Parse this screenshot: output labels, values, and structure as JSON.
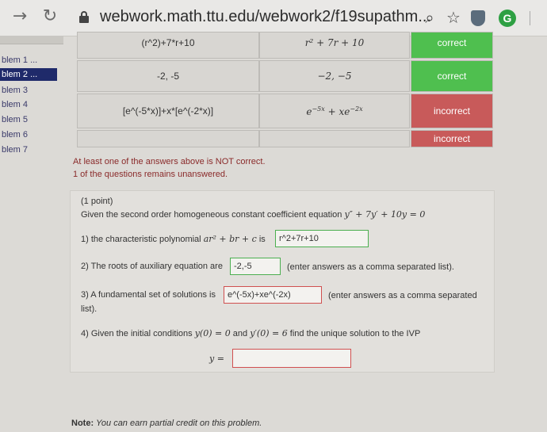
{
  "browser": {
    "url": "webwork.math.ttu.edu/webwork2/f19supathm...",
    "g_label": "G"
  },
  "sidebar": {
    "items": [
      {
        "label": "blem 1 ..."
      },
      {
        "label": "blem 2 ..."
      },
      {
        "label": "blem 3"
      },
      {
        "label": "blem 4"
      },
      {
        "label": "blem 5"
      },
      {
        "label": "blem 6"
      },
      {
        "label": "blem 7"
      }
    ]
  },
  "results": {
    "rows": [
      {
        "entered": "(r^2)+7*r+10",
        "preview": "r² + 7r + 10",
        "result": "correct"
      },
      {
        "entered": "-2, -5",
        "preview": "−2, −5",
        "result": "correct"
      },
      {
        "entered": "[e^(-5*x)]+x*[e^(-2*x)]",
        "preview": "e^{−5x} + xe^{−2x}",
        "result": "incorrect"
      },
      {
        "entered": "",
        "preview": "",
        "result": "incorrect"
      }
    ],
    "colors": {
      "correct": "#4fbf4f",
      "incorrect": "#c85a5a"
    }
  },
  "messages": {
    "not_correct": "At least one of the answers above is NOT correct.",
    "unanswered": "1 of the questions remains unanswered."
  },
  "problem": {
    "points": "(1 point)",
    "intro": "Given the second order homogeneous constant coefficient equation",
    "equation": "y″ + 7y′ + 10y = 0",
    "q1_prefix": "1) the characteristic polynomial",
    "q1_math": "ar² + br + c",
    "q1_is": "is",
    "q1_answer": "r^2+7r+10",
    "q2_prefix": "2) The roots of auxiliary equation are",
    "q2_answer": "-2,-5",
    "q2_suffix": "(enter answers as a comma separated list).",
    "q3_prefix": "3) A fundamental set of solutions is",
    "q3_answer": "e^(-5x)+xe^(-2x)",
    "q3_suffix": "(enter answers as a comma separated",
    "q3_suffix2": "list).",
    "q4_prefix": "4) Given the initial conditions",
    "q4_cond1": "y(0) = 0",
    "q4_and": "and",
    "q4_cond2": "y′(0) = 6",
    "q4_suffix": "find the unique solution to the IVP",
    "y_label": "y =",
    "y_answer": ""
  },
  "note": {
    "label": "Note:",
    "text": "You can earn partial credit on this problem."
  }
}
